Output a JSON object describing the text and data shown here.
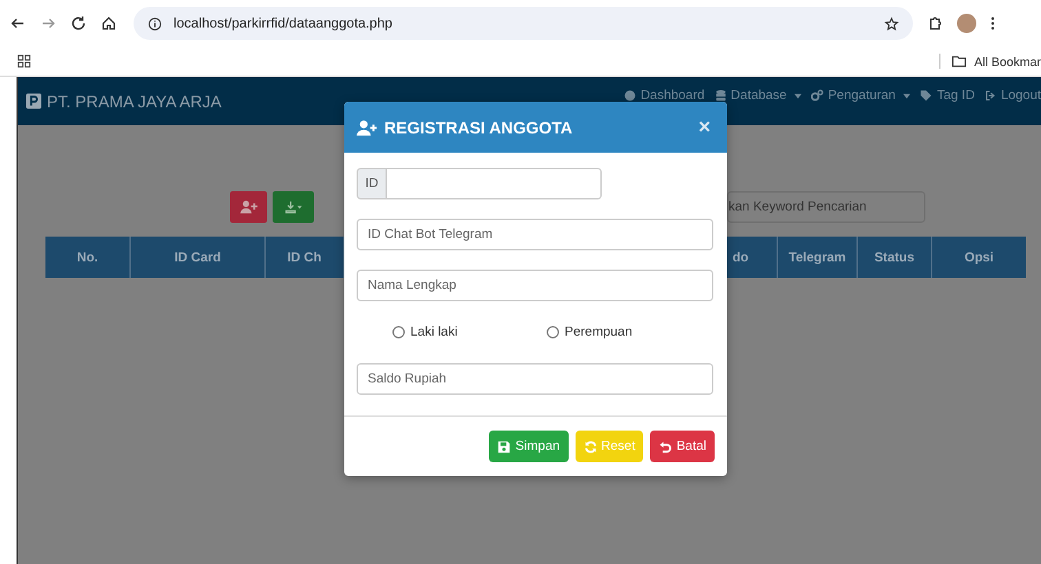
{
  "browser": {
    "url": "localhost/parkirrfid/dataanggota.php",
    "bookmarks": "All Bookmar"
  },
  "navbar": {
    "brand": "PT. PRAMA JAYA ARJA",
    "items": [
      {
        "label": "Dashboard",
        "kind": "home",
        "dropdown": false
      },
      {
        "label": "Database",
        "kind": "database",
        "dropdown": true
      },
      {
        "label": "Pengaturan",
        "kind": "gears",
        "dropdown": true
      },
      {
        "label": "Tag ID",
        "kind": "tag",
        "dropdown": false
      },
      {
        "label": "Logout",
        "kind": "logout",
        "dropdown": false
      }
    ]
  },
  "search": {
    "placeholder": "kan Keyword Pencarian"
  },
  "table": {
    "columns": [
      "No.",
      "ID Card",
      "ID Ch",
      "do",
      "Telegram",
      "Status",
      "Opsi"
    ]
  },
  "modal": {
    "title": "REGISTRASI ANGGOTA",
    "close": "×",
    "id_label": "ID",
    "fields": [
      {
        "placeholder": "ID Chat Bot Telegram"
      },
      {
        "placeholder": "Nama Lengkap"
      }
    ],
    "gender": [
      {
        "label": "Laki laki",
        "selected": false
      },
      {
        "label": "Perempuan",
        "selected": false
      }
    ],
    "saldo": {
      "placeholder": "Saldo Rupiah"
    },
    "buttons": [
      {
        "label": "Simpan",
        "kind": "save"
      },
      {
        "label": "Reset",
        "kind": "reset"
      },
      {
        "label": "Batal",
        "kind": "cancel"
      }
    ]
  }
}
